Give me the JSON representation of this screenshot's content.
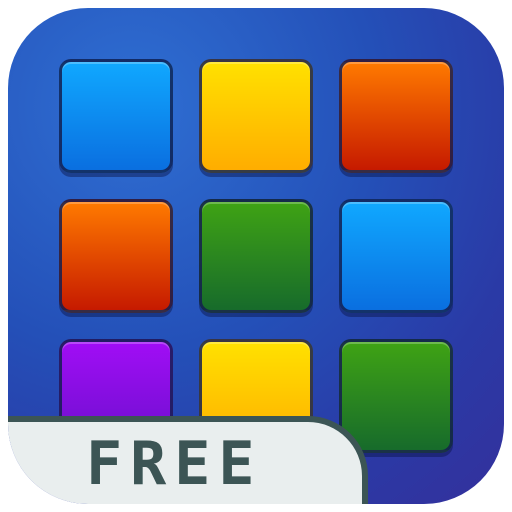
{
  "badge": {
    "label": "FREE"
  },
  "tiles": [
    {
      "name": "tile-r1c1",
      "color_top": "#10a8ff",
      "color_bottom": "#0a6fe0"
    },
    {
      "name": "tile-r1c2",
      "color_top": "#ffe100",
      "color_bottom": "#ffad00"
    },
    {
      "name": "tile-r1c3",
      "color_top": "#ff7a00",
      "color_bottom": "#c61a00"
    },
    {
      "name": "tile-r2c1",
      "color_top": "#ff7a00",
      "color_bottom": "#c61a00"
    },
    {
      "name": "tile-r2c2",
      "color_top": "#3fa314",
      "color_bottom": "#176b2b"
    },
    {
      "name": "tile-r2c3",
      "color_top": "#10a8ff",
      "color_bottom": "#0a6fe0"
    },
    {
      "name": "tile-r3c1",
      "color_top": "#a10df5",
      "color_bottom": "#6a10cc"
    },
    {
      "name": "tile-r3c2",
      "color_top": "#ffe100",
      "color_bottom": "#ffad00"
    },
    {
      "name": "tile-r3c3",
      "color_top": "#3fa314",
      "color_bottom": "#176b2b"
    }
  ]
}
